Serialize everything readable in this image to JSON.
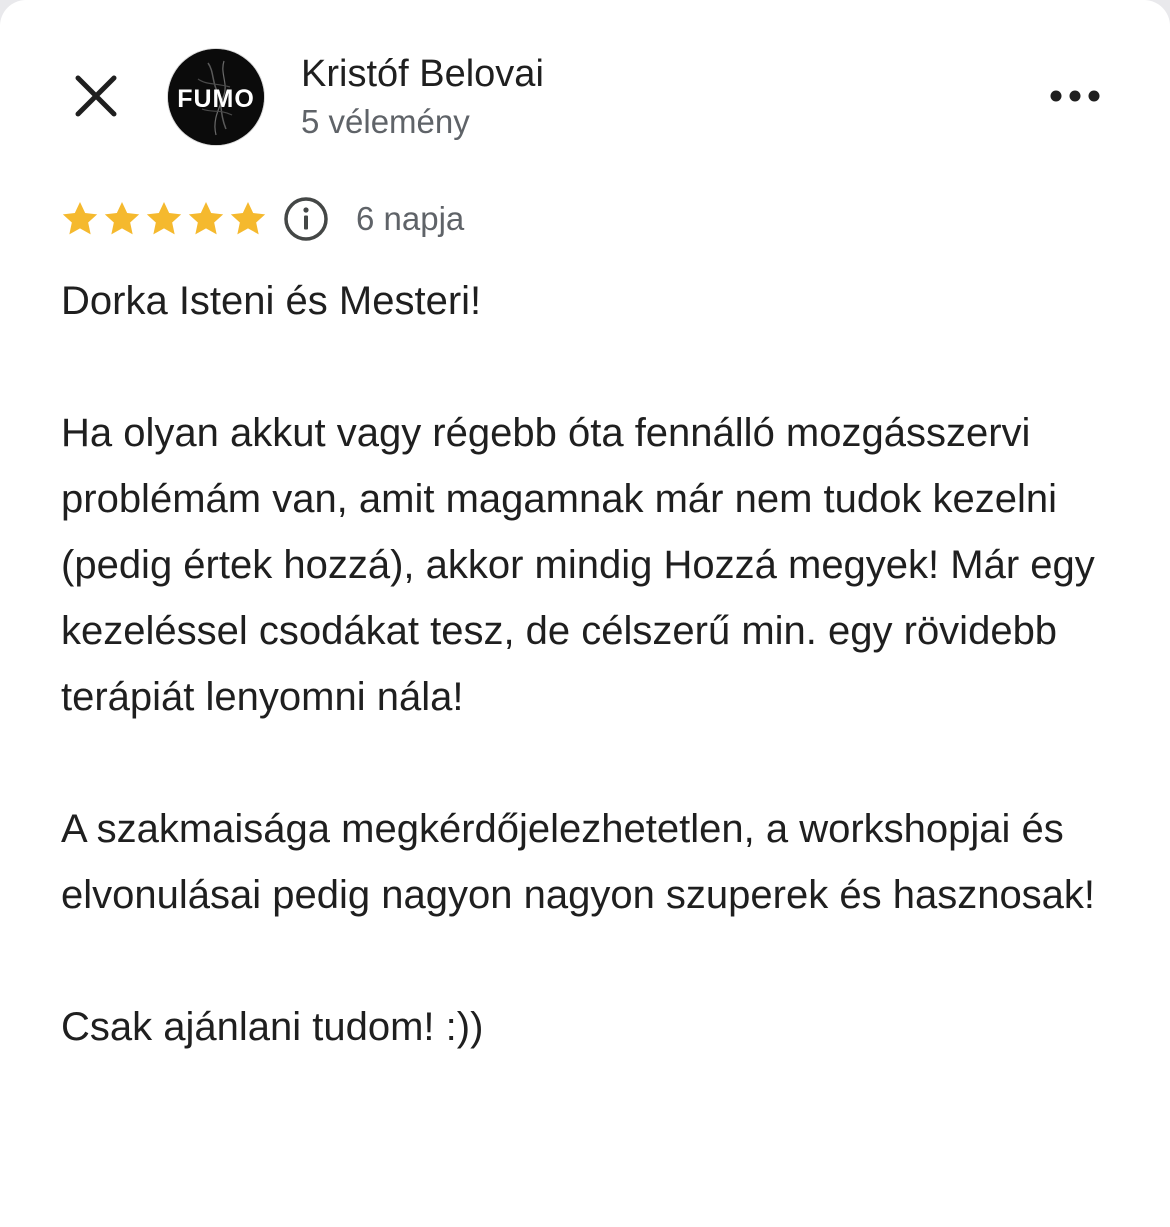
{
  "reviewer": {
    "name": "Kristóf Belovai",
    "review_count": "5 vélemény",
    "avatar_text": "FUMO"
  },
  "review": {
    "rating": 5,
    "rating_max": 5,
    "date": "6 napja",
    "paragraphs": [
      "Dorka Isteni és Mesteri!",
      "Ha olyan akkut vagy régebb óta fennálló mozgásszervi problémám van, amit magamnak már nem tudok kezelni (pedig értek hozzá), akkor mindig Hozzá megyek! Már egy kezeléssel csodákat tesz, de célszerű min. egy rövidebb terápiát lenyomni nála!",
      "A szakmaisága megkérdőjelezhetetlen, a workshopjai és elvonulásai pedig nagyon nagyon szuperek és hasznosak!",
      "Csak ajánlani tudom! :))"
    ]
  },
  "icons": {
    "close": "close-icon",
    "more": "more-horizontal-icon",
    "star": "star-icon",
    "info": "info-icon"
  },
  "colors": {
    "star": "#f5b92e",
    "secondary_text": "#5f6368",
    "primary_text": "#1f1f1f",
    "icon": "#444746"
  }
}
